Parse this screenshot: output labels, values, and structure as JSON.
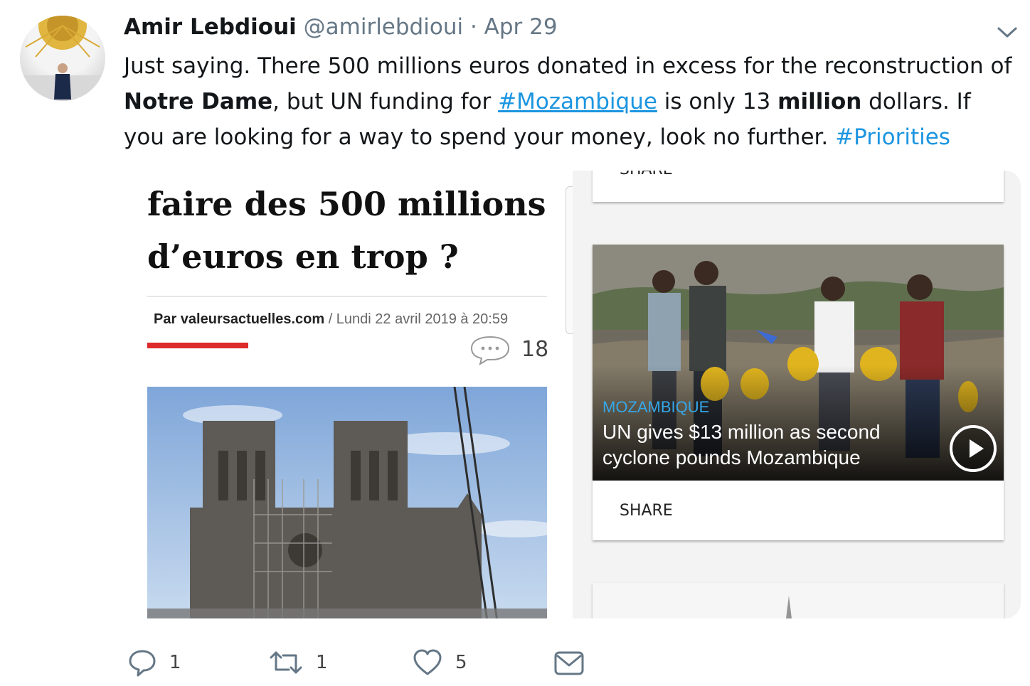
{
  "tweet": {
    "author_name": "Amir Lebdioui",
    "handle": "@amirlebdioui",
    "separator": "·",
    "date": "Apr 29",
    "text": {
      "p1": "Just saying. There 500 millions euros donated in excess for the reconstruction of ",
      "b1": "Notre Dame",
      "p2": ", but UN funding for ",
      "h1": "#Mozambique",
      "p3": " is only 13 ",
      "b2": "million",
      "p4": " dollars. If you are looking for a way to spend your money, look no further. ",
      "h2": "#Priorities"
    }
  },
  "left_screenshot": {
    "headline_line1": "faire des 500 millions",
    "headline_line2": "d’euros en trop ?",
    "byline_source": "Par valeursactuelles.com",
    "byline_rest": " / Lundi 22 avril 2019 à 20:59",
    "comment_count": "18"
  },
  "right_screenshot": {
    "top_share": "SHARE",
    "kicker": "MOZAMBIQUE",
    "headline": "UN gives $13 million as second cyclone pounds Mozambique",
    "share": "SHARE"
  },
  "actions": {
    "replies": "1",
    "retweets": "1",
    "likes": "5"
  },
  "icons": {
    "reply": "reply-icon",
    "retweet": "retweet-icon",
    "like": "heart-icon",
    "dm": "envelope-icon",
    "caret": "chevron-down-icon",
    "play": "play-icon"
  },
  "colors": {
    "hashtag": "#1b95e0",
    "secondary_text": "#657786",
    "kicker": "#35a7e8",
    "red_bar": "#dd2a2a"
  }
}
